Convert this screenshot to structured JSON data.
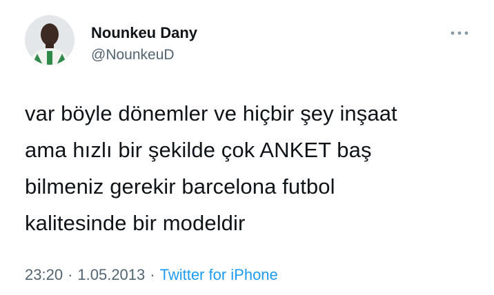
{
  "author": {
    "display_name": "Nounkeu Dany",
    "handle": "@NounkeuD"
  },
  "more_icon": "ellipsis-icon",
  "tweet": {
    "lines": [
      "var böyle dönemler ve hiçbir şey inşaat",
      "ama hızlı bir şekilde çok ANKET baş",
      "bilmeniz gerekir barcelona futbol",
      "kalitesinde bir modeldir"
    ]
  },
  "meta": {
    "time": "23:20",
    "separator": "·",
    "date": "1.05.2013",
    "source": "Twitter for iPhone"
  },
  "colors": {
    "text_primary": "#0f1419",
    "text_secondary": "#536471",
    "link": "#1d9bf0",
    "background": "#ffffff"
  }
}
